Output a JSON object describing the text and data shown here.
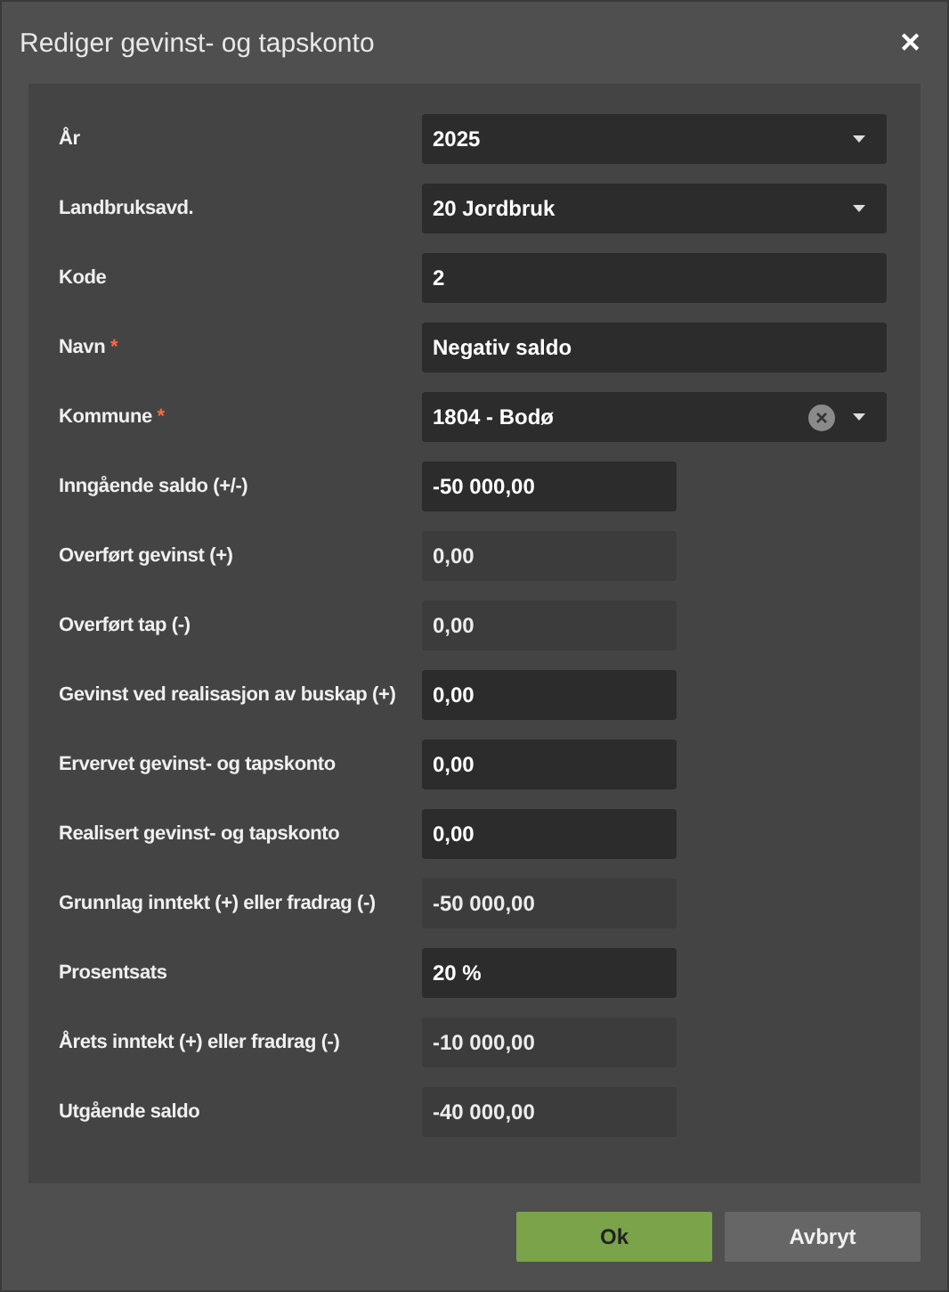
{
  "window": {
    "title": "Rediger gevinst- og tapskonto",
    "close": "✕"
  },
  "fields": [
    {
      "label": "År",
      "kind": "select",
      "value": "2025",
      "disabled": false
    },
    {
      "label": "Landbruksavd.",
      "kind": "select",
      "value": "20 Jordbruk",
      "disabled": false
    },
    {
      "label": "Kode",
      "kind": "text",
      "value": "2",
      "disabled": false
    },
    {
      "label": "Navn",
      "required_mark": "*",
      "kind": "text",
      "value": "Negativ saldo",
      "disabled": false
    },
    {
      "label": "Kommune",
      "required_mark": "*",
      "kind": "select",
      "clearable": true,
      "value": "1804 - Bodø",
      "disabled": false
    },
    {
      "label": "Inngående saldo (+/-)",
      "kind": "number",
      "value": "-50 000,00",
      "disabled": false
    },
    {
      "label": "Overført gevinst (+)",
      "kind": "number",
      "value": "0,00",
      "disabled": true
    },
    {
      "label": "Overført tap (-)",
      "kind": "number",
      "value": "0,00",
      "disabled": true
    },
    {
      "label": "Gevinst ved realisasjon av buskap (+)",
      "kind": "number",
      "value": "0,00",
      "disabled": false
    },
    {
      "label": "Ervervet gevinst- og tapskonto",
      "kind": "number",
      "value": "0,00",
      "disabled": false
    },
    {
      "label": "Realisert gevinst- og tapskonto",
      "kind": "number",
      "value": "0,00",
      "disabled": false
    },
    {
      "label": "Grunnlag inntekt (+) eller fradrag (-)",
      "kind": "number",
      "value": "-50 000,00",
      "disabled": true
    },
    {
      "label": "Prosentsats",
      "kind": "number",
      "value": "20 %",
      "disabled": false
    },
    {
      "label": "Årets inntekt (+) eller fradrag (-)",
      "kind": "number",
      "value": "-10 000,00",
      "disabled": true
    },
    {
      "label": "Utgående saldo",
      "kind": "number",
      "value": "-40 000,00",
      "disabled": true
    }
  ],
  "buttons": [
    {
      "label": "Ok",
      "kind": "primary"
    },
    {
      "label": "Avbryt",
      "kind": "secondary"
    }
  ]
}
